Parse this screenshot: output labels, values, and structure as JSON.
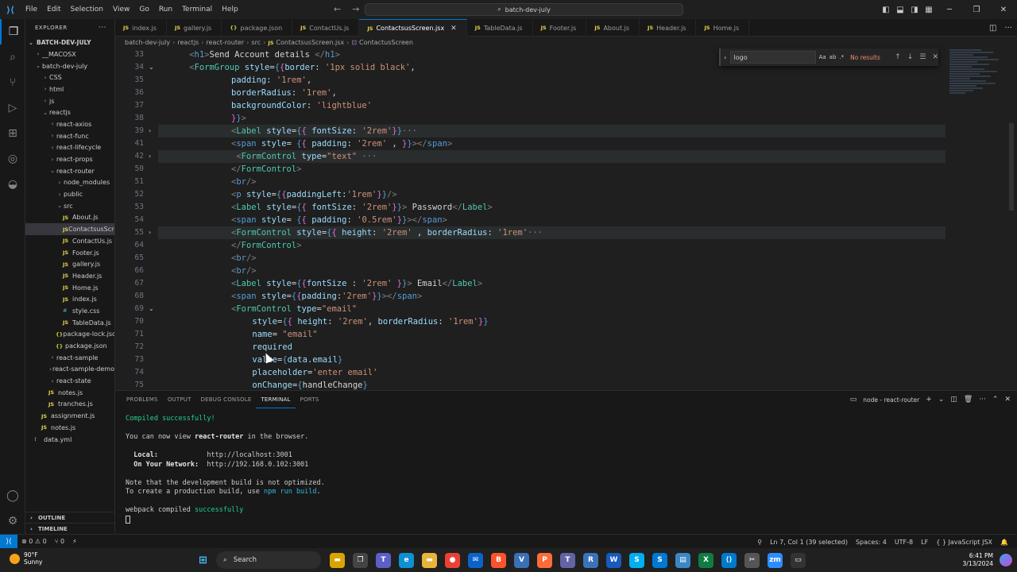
{
  "titlebar": {
    "menu": [
      "File",
      "Edit",
      "Selection",
      "View",
      "Go",
      "Run",
      "Terminal",
      "Help"
    ],
    "search_text": "batch-dev-july"
  },
  "sidebar": {
    "header": "EXPLORER",
    "root": "BATCH-DEV-JULY",
    "items": [
      {
        "label": "__MACOSX",
        "indent": 1,
        "kind": "folder",
        "open": false
      },
      {
        "label": "batch-dev-july",
        "indent": 1,
        "kind": "folder",
        "open": true
      },
      {
        "label": "CSS",
        "indent": 2,
        "kind": "folder",
        "open": false
      },
      {
        "label": "html",
        "indent": 2,
        "kind": "folder",
        "open": false
      },
      {
        "label": "js",
        "indent": 2,
        "kind": "folder",
        "open": false
      },
      {
        "label": "reactjs",
        "indent": 2,
        "kind": "folder",
        "open": true
      },
      {
        "label": "react-axios",
        "indent": 3,
        "kind": "folder",
        "open": false
      },
      {
        "label": "react-func",
        "indent": 3,
        "kind": "folder",
        "open": false
      },
      {
        "label": "react-lifecycle",
        "indent": 3,
        "kind": "folder",
        "open": false
      },
      {
        "label": "react-props",
        "indent": 3,
        "kind": "folder",
        "open": false
      },
      {
        "label": "react-router",
        "indent": 3,
        "kind": "folder",
        "open": true
      },
      {
        "label": "node_modules",
        "indent": 4,
        "kind": "folder",
        "open": false
      },
      {
        "label": "public",
        "indent": 4,
        "kind": "folder",
        "open": false
      },
      {
        "label": "src",
        "indent": 4,
        "kind": "folder",
        "open": true
      },
      {
        "label": "About.js",
        "indent": 5,
        "kind": "js"
      },
      {
        "label": "ContactsusScre...",
        "indent": 5,
        "kind": "js",
        "selected": true
      },
      {
        "label": "ContactUs.js",
        "indent": 5,
        "kind": "js"
      },
      {
        "label": "Footer.js",
        "indent": 5,
        "kind": "js"
      },
      {
        "label": "gallery.js",
        "indent": 5,
        "kind": "js"
      },
      {
        "label": "Header.js",
        "indent": 5,
        "kind": "js"
      },
      {
        "label": "Home.js",
        "indent": 5,
        "kind": "js"
      },
      {
        "label": "index.js",
        "indent": 5,
        "kind": "js"
      },
      {
        "label": "style.css",
        "indent": 5,
        "kind": "css"
      },
      {
        "label": "TableData.js",
        "indent": 5,
        "kind": "js"
      },
      {
        "label": "package-lock.json",
        "indent": 4,
        "kind": "json"
      },
      {
        "label": "package.json",
        "indent": 4,
        "kind": "json"
      },
      {
        "label": "react-sample",
        "indent": 3,
        "kind": "folder",
        "open": false
      },
      {
        "label": "react-sample-demo",
        "indent": 3,
        "kind": "folder",
        "open": false
      },
      {
        "label": "react-state",
        "indent": 3,
        "kind": "folder",
        "open": false
      },
      {
        "label": "notes.js",
        "indent": 3,
        "kind": "js"
      },
      {
        "label": "tranches.js",
        "indent": 3,
        "kind": "js"
      },
      {
        "label": "assignment.js",
        "indent": 2,
        "kind": "js"
      },
      {
        "label": "notes.js",
        "indent": 2,
        "kind": "js"
      },
      {
        "label": "data.yml",
        "indent": 1,
        "kind": "yml"
      }
    ],
    "outline": "OUTLINE",
    "timeline": "TIMELINE"
  },
  "tabs": [
    {
      "label": "index.js",
      "kind": "js"
    },
    {
      "label": "gallery.js",
      "kind": "js"
    },
    {
      "label": "package.json",
      "kind": "json"
    },
    {
      "label": "ContactUs.js",
      "kind": "js"
    },
    {
      "label": "ContactsusScreen.jsx",
      "kind": "js",
      "active": true
    },
    {
      "label": "TableData.js",
      "kind": "js"
    },
    {
      "label": "Footer.js",
      "kind": "js"
    },
    {
      "label": "About.js",
      "kind": "js"
    },
    {
      "label": "Header.js",
      "kind": "js"
    },
    {
      "label": "Home.js",
      "kind": "js"
    }
  ],
  "breadcrumb": [
    "batch-dev-july",
    "reactjs",
    "react-router",
    "src",
    "ContactsusScreen.jsx",
    "ContactusScreen"
  ],
  "find": {
    "value": "logo",
    "options": [
      "Aa",
      "ab",
      ".*"
    ],
    "result": "No results"
  },
  "editor": {
    "lines": [
      {
        "n": "33",
        "fold": "",
        "hl": false,
        "html": "<span class='tg'>&lt;</span><span class='jx'>h1</span><span class='tg'>&gt;</span><span class='pl'>Send Account details </span><span class='tg'>&lt;/</span><span class='jx'>h1</span><span class='tg'>&gt;</span>",
        "indent": 2
      },
      {
        "n": "34",
        "fold": "⌄",
        "hl": false,
        "html": "<span class='tg'>&lt;</span><span class='tn'>FormGroup</span> <span class='at'>style</span><span class='pl'>=</span><span class='jx'>{</span><span class='br'>{</span><span class='at'>border</span><span class='pl'>: </span><span class='st'>'1px solid black'</span><span class='pl'>,</span>",
        "indent": 2
      },
      {
        "n": "35",
        "fold": "",
        "hl": false,
        "html": "<span class='at'>padding</span><span class='pl'>: </span><span class='st'>'1rem'</span><span class='pl'>,</span>",
        "indent": 10
      },
      {
        "n": "36",
        "fold": "",
        "hl": false,
        "html": "<span class='at'>borderRadius</span><span class='pl'>: </span><span class='st'>'1rem'</span><span class='pl'>,</span>",
        "indent": 10
      },
      {
        "n": "37",
        "fold": "",
        "hl": false,
        "html": "<span class='at'>backgroundColor</span><span class='pl'>: </span><span class='st'>'lightblue'</span>",
        "indent": 10
      },
      {
        "n": "38",
        "fold": "",
        "hl": false,
        "html": "<span class='br'>}</span><span class='jx'>}</span><span class='tg'>&gt;</span>",
        "indent": 10
      },
      {
        "n": "39",
        "fold": "›",
        "hl": true,
        "html": "<span class='tg'>&lt;</span><span class='tn'>Label</span> <span class='at'>style</span><span class='pl'>=</span><span class='jx'>{</span><span class='br'>{</span> <span class='at'>fontSize</span><span class='pl'>: </span><span class='st'>'2rem'</span><span class='br'>}</span><span class='jx'>}</span><span class='elp'>···</span>",
        "indent": 10
      },
      {
        "n": "41",
        "fold": "",
        "hl": false,
        "html": "<span class='tg'>&lt;</span><span class='jx'>span</span> <span class='at'>style</span><span class='pl'>= </span><span class='jx'>{</span><span class='br'>{</span> <span class='at'>padding</span><span class='pl'>: </span><span class='st'>'2rem'</span><span class='pl'> , </span><span class='br'>}</span><span class='jx'>}</span><span class='tg'>&gt;&lt;/</span><span class='jx'>span</span><span class='tg'>&gt;</span>",
        "indent": 10
      },
      {
        "n": "42",
        "fold": "›",
        "hl": true,
        "html": " <span class='tg'>&lt;</span><span class='tn'>FormControl</span> <span class='at'>type</span><span class='pl'>=</span><span class='st'>\"text\"</span> <span class='elp'>···</span>",
        "indent": 10
      },
      {
        "n": "50",
        "fold": "",
        "hl": false,
        "html": "<span class='tg'>&lt;/</span><span class='tn'>FormControl</span><span class='tg'>&gt;</span>",
        "indent": 10
      },
      {
        "n": "51",
        "fold": "",
        "hl": false,
        "html": "<span class='tg'>&lt;</span><span class='jx'>br</span><span class='tg'>/&gt;</span>",
        "indent": 10
      },
      {
        "n": "52",
        "fold": "",
        "hl": false,
        "html": "<span class='tg'>&lt;</span><span class='jx'>p</span> <span class='at'>style</span><span class='pl'>=</span><span class='jx'>{</span><span class='br'>{</span><span class='at'>paddingLeft</span><span class='pl'>:</span><span class='st'>'1rem'</span><span class='br'>}</span><span class='jx'>}</span><span class='tg'>/&gt;</span>",
        "indent": 10
      },
      {
        "n": "53",
        "fold": "",
        "hl": false,
        "html": "<span class='tg'>&lt;</span><span class='tn'>Label</span> <span class='at'>style</span><span class='pl'>=</span><span class='jx'>{</span><span class='br'>{</span> <span class='at'>fontSize</span><span class='pl'>: </span><span class='st'>'2rem'</span><span class='br'>}</span><span class='jx'>}</span><span class='tg'>&gt;</span><span class='pl'> Password</span><span class='tg'>&lt;/</span><span class='tn'>Label</span><span class='tg'>&gt;</span>",
        "indent": 10
      },
      {
        "n": "54",
        "fold": "",
        "hl": false,
        "html": "<span class='tg'>&lt;</span><span class='jx'>span</span> <span class='at'>style</span><span class='pl'>= </span><span class='jx'>{</span><span class='br'>{</span> <span class='at'>padding</span><span class='pl'>: </span><span class='st'>'0.5rem'</span><span class='br'>}</span><span class='jx'>}</span><span class='tg'>&gt;&lt;/</span><span class='jx'>span</span><span class='tg'>&gt;</span>",
        "indent": 10
      },
      {
        "n": "55",
        "fold": "›",
        "hl": true,
        "html": "<span class='tg'>&lt;</span><span class='tn'>FormControl</span> <span class='at'>style</span><span class='pl'>=</span><span class='jx'>{</span><span class='br'>{</span> <span class='at'>height</span><span class='pl'>: </span><span class='st'>'2rem'</span><span class='pl'> , </span><span class='at'>borderRadius</span><span class='pl'>: </span><span class='st'>'1rem'</span><span class='elp'>···</span>",
        "indent": 10
      },
      {
        "n": "64",
        "fold": "",
        "hl": false,
        "html": "<span class='tg'>&lt;/</span><span class='tn'>FormControl</span><span class='tg'>&gt;</span>",
        "indent": 10
      },
      {
        "n": "65",
        "fold": "",
        "hl": false,
        "html": "<span class='tg'>&lt;</span><span class='jx'>br</span><span class='tg'>/&gt;</span>",
        "indent": 10
      },
      {
        "n": "66",
        "fold": "",
        "hl": false,
        "html": "<span class='tg'>&lt;</span><span class='jx'>br</span><span class='tg'>/&gt;</span>",
        "indent": 10
      },
      {
        "n": "67",
        "fold": "",
        "hl": false,
        "html": "<span class='tg'>&lt;</span><span class='tn'>Label</span> <span class='at'>style</span><span class='pl'>=</span><span class='jx'>{</span><span class='br'>{</span><span class='at'>fontSize</span><span class='pl'> : </span><span class='st'>'2rem'</span> <span class='br'>}</span><span class='jx'>}</span><span class='tg'>&gt;</span><span class='pl'> Email</span><span class='tg'>&lt;/</span><span class='tn'>Label</span><span class='tg'>&gt;</span>",
        "indent": 10
      },
      {
        "n": "68",
        "fold": "",
        "hl": false,
        "html": "<span class='tg'>&lt;</span><span class='jx'>span</span> <span class='at'>style</span><span class='pl'>=</span><span class='jx'>{</span><span class='br'>{</span><span class='at'>padding</span><span class='pl'>:</span><span class='st'>'2rem'</span><span class='br'>}</span><span class='jx'>}</span><span class='tg'>&gt;&lt;/</span><span class='jx'>span</span><span class='tg'>&gt;</span>",
        "indent": 10
      },
      {
        "n": "69",
        "fold": "⌄",
        "hl": false,
        "html": "<span class='tg'>&lt;</span><span class='tn'>FormControl</span> <span class='at'>type</span><span class='pl'>=</span><span class='st'>\"email\"</span>",
        "indent": 10
      },
      {
        "n": "70",
        "fold": "",
        "hl": false,
        "html": "<span class='at'>style</span><span class='pl'>=</span><span class='jx'>{</span><span class='br'>{</span> <span class='at'>height</span><span class='pl'>: </span><span class='st'>'2rem'</span><span class='pl'>, </span><span class='at'>borderRadius</span><span class='pl'>: </span><span class='st'>'1rem'</span><span class='br'>}</span><span class='jx'>}</span>",
        "indent": 14
      },
      {
        "n": "71",
        "fold": "",
        "hl": false,
        "html": "<span class='at'>name</span><span class='pl'>= </span><span class='st'>\"email\"</span>",
        "indent": 14
      },
      {
        "n": "72",
        "fold": "",
        "hl": false,
        "html": "<span class='at'>required</span>",
        "indent": 14
      },
      {
        "n": "73",
        "fold": "",
        "hl": false,
        "html": "<span class='at'>value</span><span class='pl'>=</span><span class='jx'>{</span><span class='at'>data</span><span class='pl'>.</span><span class='at'>email</span><span class='jx'>}</span>",
        "indent": 14
      },
      {
        "n": "74",
        "fold": "",
        "hl": false,
        "html": "<span class='at'>placeholder</span><span class='pl'>=</span><span class='st'>'enter email'</span>",
        "indent": 14
      },
      {
        "n": "75",
        "fold": "",
        "hl": false,
        "html": "<span class='at'>onChange</span><span class='pl'>=</span><span class='jx'>{</span><span class='pl'>handleChange</span><span class='jx'>}</span>",
        "indent": 14
      }
    ]
  },
  "panel": {
    "tabs": [
      "PROBLEMS",
      "OUTPUT",
      "DEBUG CONSOLE",
      "TERMINAL",
      "PORTS"
    ],
    "active_tab": "TERMINAL",
    "terminal_name": "node - react-router",
    "terminal": {
      "compiled": "Compiled successfully!",
      "view_prefix": "You can now view ",
      "view_app": "react-router",
      "view_suffix": " in the browser.",
      "local_label": "  Local:            ",
      "local_url": "http://localhost:3001",
      "network_label": "  On Your Network:  ",
      "network_url": "http://192.168.0.102:3001",
      "note1": "Note that the development build is not optimized.",
      "note2_prefix": "To create a production build, use ",
      "note2_cmd": "npm run build",
      "note2_suffix": ".",
      "webpack_prefix": "webpack compiled ",
      "webpack_status": "successfully"
    }
  },
  "statusbar": {
    "errors": "⊗ 0 ⚠ 0",
    "ports": "⑂ 0",
    "position": "Ln 7, Col 1 (39 selected)",
    "spaces": "Spaces: 4",
    "encoding": "UTF-8",
    "eol": "LF",
    "language": "{ } JavaScript JSX"
  },
  "taskbar": {
    "temp": "90°F",
    "condition": "Sunny",
    "search": "Search",
    "time": "6:41 PM",
    "date": "3/13/2024",
    "icons": [
      {
        "name": "file-explorer-icon",
        "label": "▬",
        "color": "#d9a400"
      },
      {
        "name": "task-view-icon",
        "label": "❐",
        "color": "#444"
      },
      {
        "name": "teams-icon",
        "label": "T",
        "color": "#5b5fc7"
      },
      {
        "name": "edge-icon",
        "label": "e",
        "color": "#0f8fd4"
      },
      {
        "name": "folder-icon",
        "label": "▬",
        "color": "#e7b53b"
      },
      {
        "name": "chrome-icon",
        "label": "●",
        "color": "#e94235"
      },
      {
        "name": "mail-icon",
        "label": "✉",
        "color": "#0a64c8"
      },
      {
        "name": "brave-icon",
        "label": "B",
        "color": "#fb542b"
      },
      {
        "name": "vpn-icon",
        "label": "V",
        "color": "#3b6fb6"
      },
      {
        "name": "postman-icon",
        "label": "P",
        "color": "#ff6c37"
      },
      {
        "name": "teams-classic-icon",
        "label": "T",
        "color": "#6264a7"
      },
      {
        "name": "remote-icon",
        "label": "R",
        "color": "#3b73b9"
      },
      {
        "name": "word-icon",
        "label": "W",
        "color": "#185abd"
      },
      {
        "name": "skype-icon",
        "label": "S",
        "color": "#00aff0"
      },
      {
        "name": "skype-business-icon",
        "label": "S",
        "color": "#0078d4"
      },
      {
        "name": "notepad-icon",
        "label": "▤",
        "color": "#3b86c4"
      },
      {
        "name": "excel-icon",
        "label": "X",
        "color": "#107c41"
      },
      {
        "name": "vscode-icon",
        "label": "⟨⟩",
        "color": "#007acc"
      },
      {
        "name": "snip-icon",
        "label": "✂",
        "color": "#555"
      },
      {
        "name": "zoom-icon",
        "label": "zm",
        "color": "#2d8cff"
      },
      {
        "name": "terminal-icon",
        "label": "▭",
        "color": "#333"
      }
    ]
  }
}
